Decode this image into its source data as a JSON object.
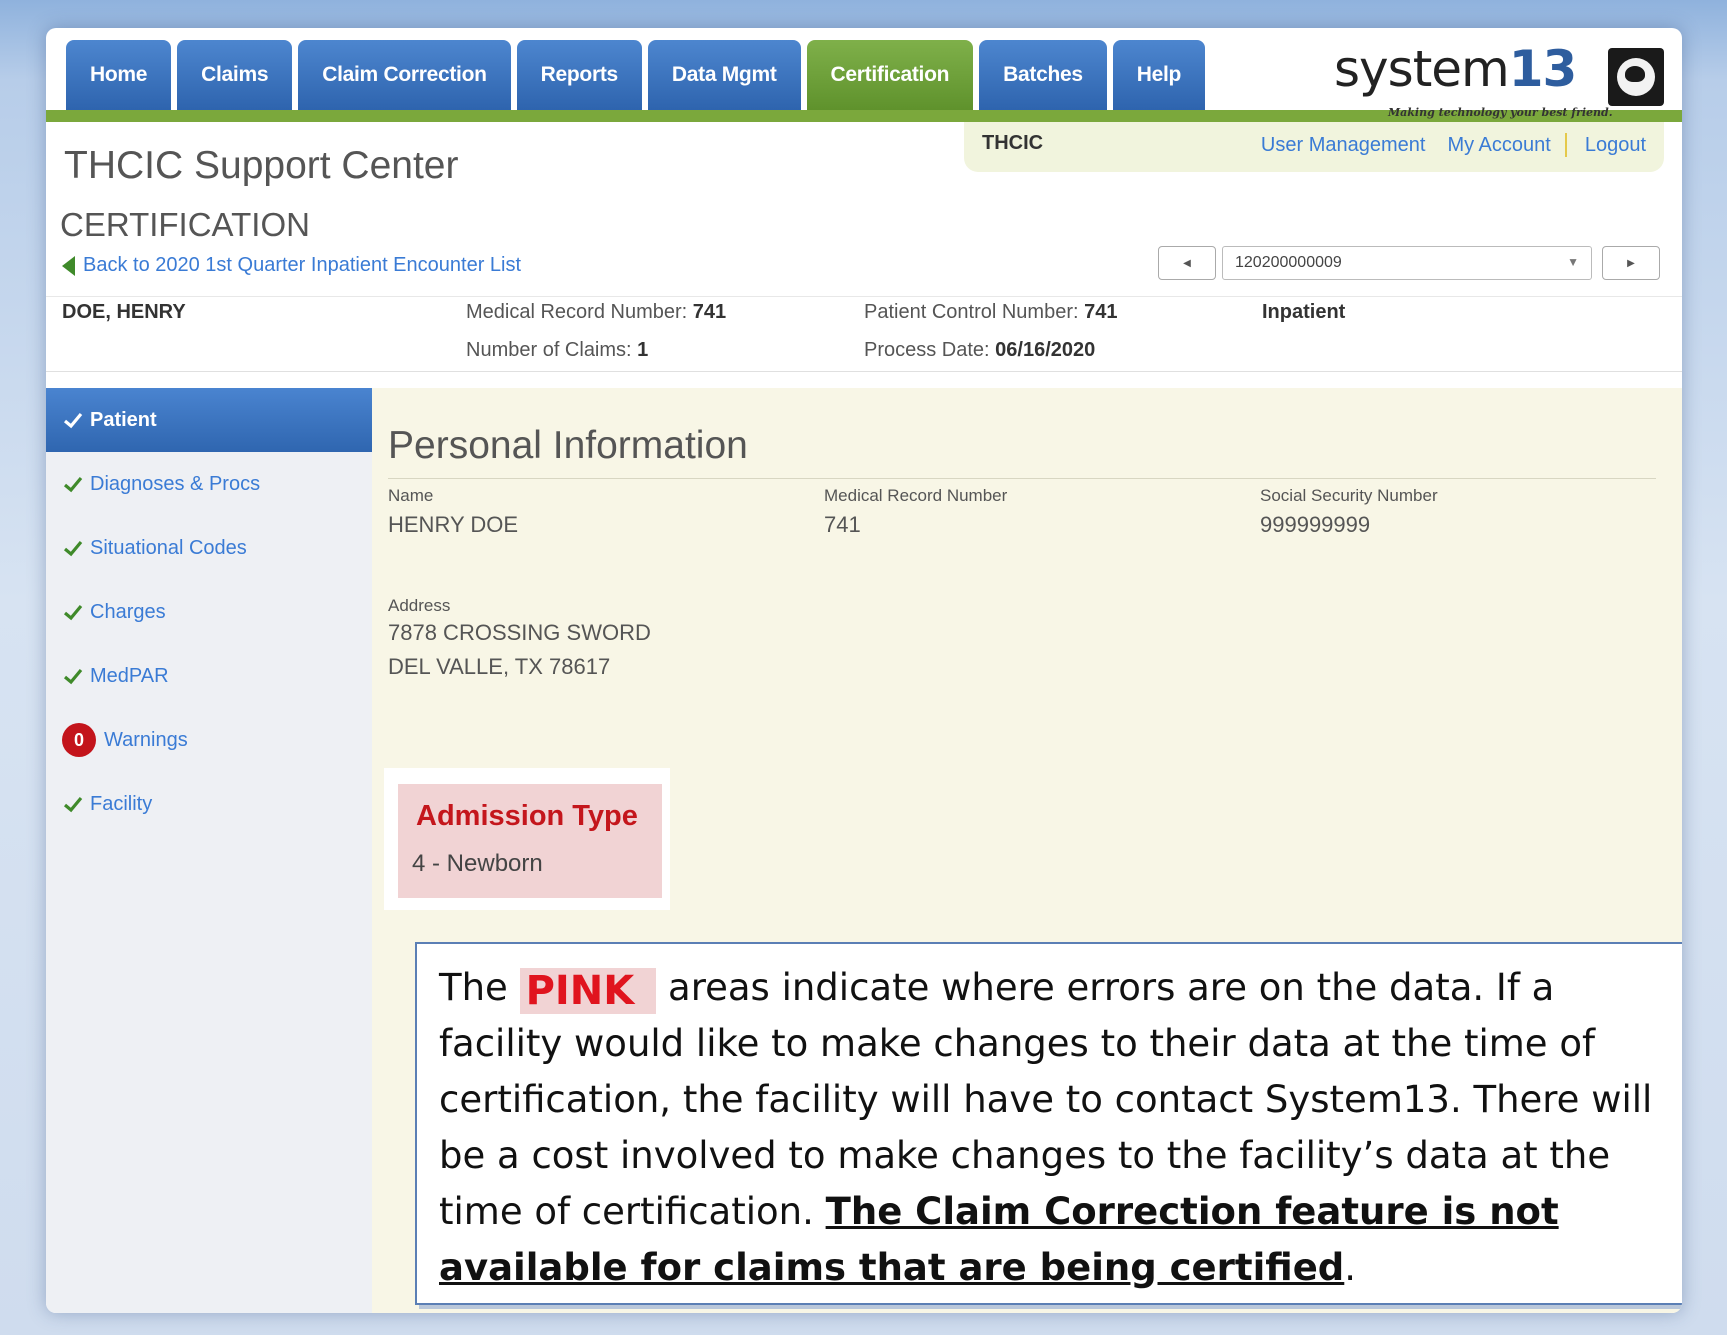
{
  "nav": {
    "tabs": [
      "Home",
      "Claims",
      "Claim Correction",
      "Reports",
      "Data Mgmt",
      "Certification",
      "Batches",
      "Help"
    ],
    "active": "Certification"
  },
  "logo": {
    "name": "system",
    "number": "13",
    "tagline": "Making technology your best friend."
  },
  "userbar": {
    "org": "THCIC",
    "user_management": "User Management",
    "my_account": "My Account",
    "logout": "Logout"
  },
  "header": {
    "site_title": "THCIC Support Center",
    "section": "CERTIFICATION",
    "back_link": "Back to 2020 1st Quarter Inpatient Encounter List",
    "selected_claim": "120200000009"
  },
  "patient": {
    "name": "DOE, HENRY",
    "mrn_label": "Medical Record Number:",
    "mrn": "741",
    "claims_label": "Number of Claims:",
    "claims": "1",
    "pcn_label": "Patient Control Number:",
    "pcn": "741",
    "process_label": "Process Date:",
    "process_date": "06/16/2020",
    "type": "Inpatient"
  },
  "sidebar": {
    "items": [
      {
        "label": "Patient",
        "status": "check",
        "active": true
      },
      {
        "label": "Diagnoses & Procs",
        "status": "check"
      },
      {
        "label": "Situational Codes",
        "status": "check"
      },
      {
        "label": "Charges",
        "status": "check"
      },
      {
        "label": "MedPAR",
        "status": "check"
      },
      {
        "label": "Warnings",
        "status": "count",
        "count": "0"
      },
      {
        "label": "Facility",
        "status": "check"
      }
    ]
  },
  "personal": {
    "title": "Personal Information",
    "name_label": "Name",
    "name": "HENRY DOE",
    "mrn_label": "Medical Record Number",
    "mrn": "741",
    "ssn_label": "Social Security Number",
    "ssn": "999999999",
    "address_label": "Address",
    "address_line1": "7878 CROSSING SWORD",
    "address_line2": "DEL VALLE, TX 78617",
    "admission_type_label": "Admission Type",
    "admission_type": "4 - Newborn"
  },
  "callout": {
    "pre": "The",
    "pink_word": "PINK",
    "body": "areas indicate where errors are on the data.  If a facility would like to make changes to their data at the time of certification, the facility will have  to contact System13. There will be a cost involved to make changes to the facility’s data at the time of certification.",
    "emphasis": "The Claim Correction feature is not available for claims that are being certified",
    "end": "."
  },
  "colors": {
    "nav_blue": "#2e64ae",
    "nav_active_green": "#5f922c",
    "link_blue": "#3a7bd5",
    "error_pink": "#f1d3d4",
    "error_red": "#c4161c",
    "check_green": "#3f8a2a"
  }
}
